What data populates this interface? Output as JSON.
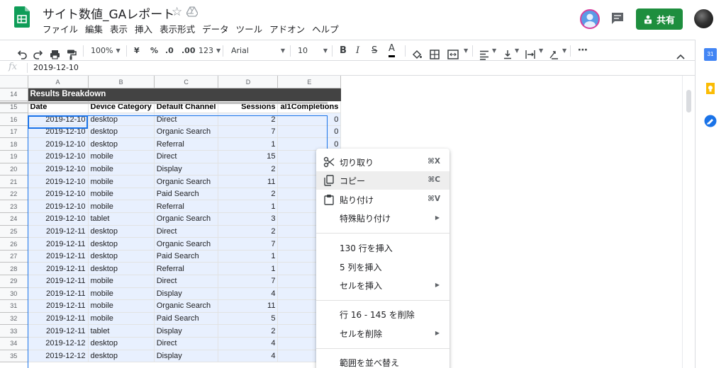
{
  "document": {
    "title": "サイト数値_GAレポート"
  },
  "menubar": [
    "ファイル",
    "編集",
    "表示",
    "挿入",
    "表示形式",
    "データ",
    "ツール",
    "アドオン",
    "ヘルプ"
  ],
  "header": {
    "share_label": "共有"
  },
  "toolbar": {
    "zoom": "100%",
    "currency": "¥",
    "percent": "%",
    "decrease_decimals": ".0",
    "increase_decimals": ".00",
    "more_formats": "123",
    "font": "Arial",
    "font_size": "10",
    "bold": "B",
    "italic": "I",
    "strikethrough": "S",
    "text_color": "A",
    "more": "⋯"
  },
  "formula_bar": {
    "fx": "fx",
    "value": "2019-12-10"
  },
  "grid": {
    "columns": [
      "A",
      "B",
      "C",
      "D",
      "E"
    ],
    "title_row": {
      "row": "14",
      "text": "Results Breakdown"
    },
    "header_row": {
      "row": "15",
      "cells": [
        "Date",
        "Device Category",
        "Default Channel",
        "Sessions",
        "al1Completions"
      ]
    },
    "rows": [
      {
        "row": "16",
        "cells": [
          "2019-12-10",
          "desktop",
          "Direct",
          "2",
          "0"
        ]
      },
      {
        "row": "17",
        "cells": [
          "2019-12-10",
          "desktop",
          "Organic Search",
          "7",
          "0"
        ]
      },
      {
        "row": "18",
        "cells": [
          "2019-12-10",
          "desktop",
          "Referral",
          "1",
          "0"
        ]
      },
      {
        "row": "19",
        "cells": [
          "2019-12-10",
          "mobile",
          "Direct",
          "15",
          ""
        ]
      },
      {
        "row": "20",
        "cells": [
          "2019-12-10",
          "mobile",
          "Display",
          "2",
          ""
        ]
      },
      {
        "row": "21",
        "cells": [
          "2019-12-10",
          "mobile",
          "Organic Search",
          "11",
          ""
        ]
      },
      {
        "row": "22",
        "cells": [
          "2019-12-10",
          "mobile",
          "Paid Search",
          "2",
          ""
        ]
      },
      {
        "row": "23",
        "cells": [
          "2019-12-10",
          "mobile",
          "Referral",
          "1",
          ""
        ]
      },
      {
        "row": "24",
        "cells": [
          "2019-12-10",
          "tablet",
          "Organic Search",
          "3",
          ""
        ]
      },
      {
        "row": "25",
        "cells": [
          "2019-12-11",
          "desktop",
          "Direct",
          "2",
          ""
        ]
      },
      {
        "row": "26",
        "cells": [
          "2019-12-11",
          "desktop",
          "Organic Search",
          "7",
          ""
        ]
      },
      {
        "row": "27",
        "cells": [
          "2019-12-11",
          "desktop",
          "Paid Search",
          "1",
          ""
        ]
      },
      {
        "row": "28",
        "cells": [
          "2019-12-11",
          "desktop",
          "Referral",
          "1",
          ""
        ]
      },
      {
        "row": "29",
        "cells": [
          "2019-12-11",
          "mobile",
          "Direct",
          "7",
          ""
        ]
      },
      {
        "row": "30",
        "cells": [
          "2019-12-11",
          "mobile",
          "Display",
          "4",
          ""
        ]
      },
      {
        "row": "31",
        "cells": [
          "2019-12-11",
          "mobile",
          "Organic Search",
          "11",
          ""
        ]
      },
      {
        "row": "32",
        "cells": [
          "2019-12-11",
          "mobile",
          "Paid Search",
          "5",
          ""
        ]
      },
      {
        "row": "33",
        "cells": [
          "2019-12-11",
          "tablet",
          "Display",
          "2",
          ""
        ]
      },
      {
        "row": "34",
        "cells": [
          "2019-12-12",
          "desktop",
          "Direct",
          "4",
          ""
        ]
      },
      {
        "row": "35",
        "cells": [
          "2019-12-12",
          "desktop",
          "Display",
          "4",
          ""
        ]
      }
    ]
  },
  "context_menu": {
    "cut": {
      "label": "切り取り",
      "shortcut": "⌘X"
    },
    "copy": {
      "label": "コピー",
      "shortcut": "⌘C"
    },
    "paste": {
      "label": "貼り付け",
      "shortcut": "⌘V"
    },
    "paste_special": {
      "label": "特殊貼り付け"
    },
    "insert_rows": {
      "label": "130 行を挿入"
    },
    "insert_cols": {
      "label": "5 列を挿入"
    },
    "insert_cells": {
      "label": "セルを挿入"
    },
    "delete_rows": {
      "label": "行 16 - 145 を削除"
    },
    "delete_cells": {
      "label": "セルを削除"
    },
    "sort_range": {
      "label": "範囲を並べ替え"
    }
  },
  "side_panel": {
    "calendar_label": "31"
  },
  "colors": {
    "accent": "#1a73e8",
    "share_green": "#1e8e3e",
    "sheets_green": "#0f9d58",
    "title_row_bg": "#434343"
  }
}
